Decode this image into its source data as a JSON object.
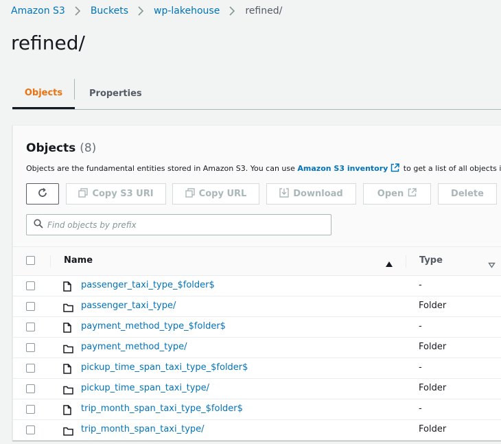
{
  "breadcrumb": [
    "Amazon S3",
    "Buckets",
    "wp-lakehouse",
    "refined/"
  ],
  "page_title": "refined/",
  "tabs": {
    "objects": "Objects",
    "properties": "Properties"
  },
  "panel": {
    "title": "Objects",
    "count": "(8)",
    "desc_prefix": "Objects are the fundamental entities stored in Amazon S3. You can use ",
    "desc_link": "Amazon S3 inventory",
    "desc_suffix": " to get a list of all objects in y"
  },
  "toolbar": {
    "copy_uri": "Copy S3 URI",
    "copy_url": "Copy URL",
    "download": "Download",
    "open": "Open",
    "delete": "Delete"
  },
  "search": {
    "placeholder": "Find objects by prefix"
  },
  "table": {
    "headers": {
      "name": "Name",
      "type": "Type"
    },
    "rows": [
      {
        "name": "passenger_taxi_type_$folder$",
        "type": "-",
        "icon": "file-icon"
      },
      {
        "name": "passenger_taxi_type/",
        "type": "Folder",
        "icon": "folder-icon"
      },
      {
        "name": "payment_method_type_$folder$",
        "type": "-",
        "icon": "file-icon"
      },
      {
        "name": "payment_method_type/",
        "type": "Folder",
        "icon": "folder-icon"
      },
      {
        "name": "pickup_time_span_taxi_type_$folder$",
        "type": "-",
        "icon": "file-icon"
      },
      {
        "name": "pickup_time_span_taxi_type/",
        "type": "Folder",
        "icon": "folder-icon"
      },
      {
        "name": "trip_month_span_taxi_type_$folder$",
        "type": "-",
        "icon": "file-icon"
      },
      {
        "name": "trip_month_span_taxi_type/",
        "type": "Folder",
        "icon": "folder-icon"
      }
    ]
  },
  "colors": {
    "link": "#0073bb",
    "active_tab": "#ec7211",
    "text": "#16191f",
    "disabled": "#aab7b8"
  }
}
